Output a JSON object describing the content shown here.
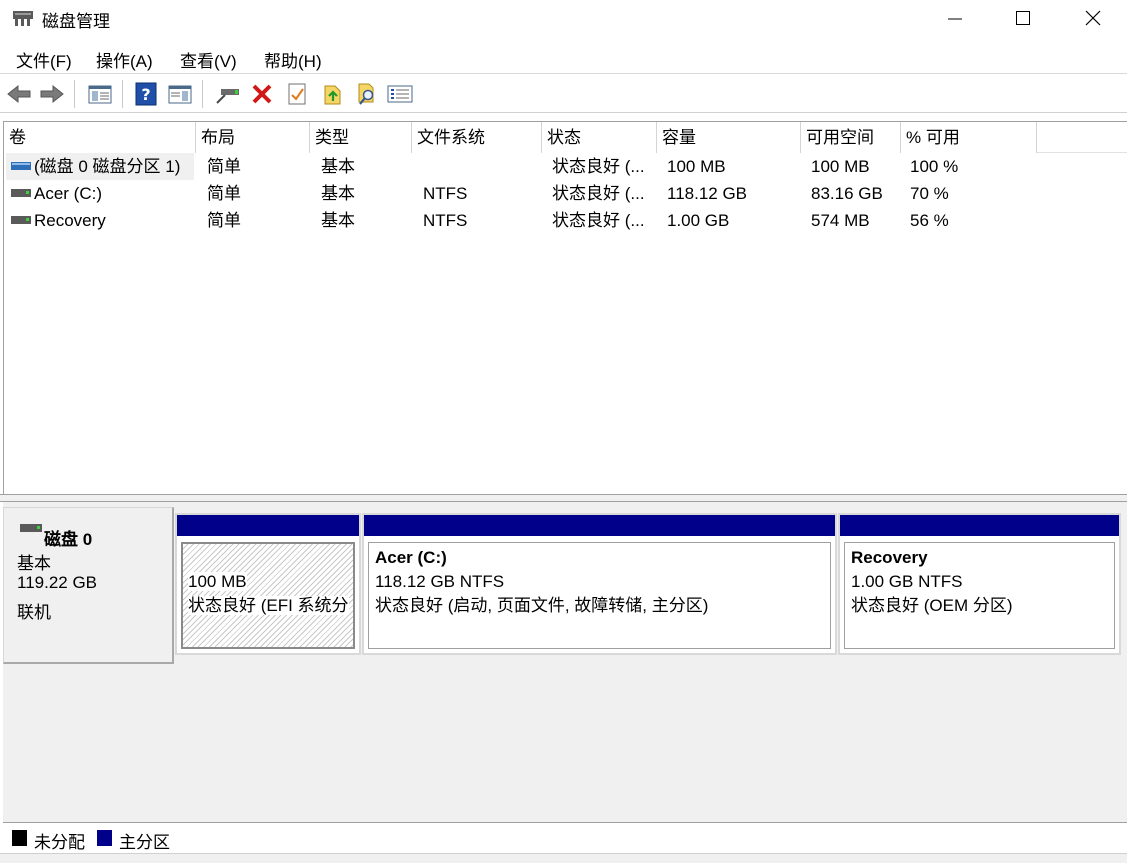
{
  "window": {
    "title": "磁盘管理",
    "controls": {
      "minimize": "minimize-icon",
      "maximize": "maximize-icon",
      "close": "close-icon"
    }
  },
  "menu": [
    "文件(F)",
    "操作(A)",
    "查看(V)",
    "帮助(H)"
  ],
  "toolbar": {
    "buttons": [
      "back-arrow-icon",
      "forward-arrow-icon",
      "console-tree-icon",
      "help-icon",
      "action-pane-icon",
      "connect-disk-icon",
      "delete-icon",
      "properties-icon",
      "export-icon",
      "search-icon",
      "list-view-icon"
    ]
  },
  "volume_table": {
    "columns": [
      "卷",
      "布局",
      "类型",
      "文件系统",
      "状态",
      "容量",
      "可用空间",
      "% 可用"
    ],
    "rows": [
      {
        "volume": "(磁盘 0 磁盘分区 1)",
        "layout": "简单",
        "type": "基本",
        "fs": "",
        "status": "状态良好 (...",
        "capacity": "100 MB",
        "free": "100 MB",
        "pct": "100 %"
      },
      {
        "volume": "Acer (C:)",
        "layout": "简单",
        "type": "基本",
        "fs": "NTFS",
        "status": "状态良好 (...",
        "capacity": "118.12 GB",
        "free": "83.16 GB",
        "pct": "70 %"
      },
      {
        "volume": "Recovery",
        "layout": "简单",
        "type": "基本",
        "fs": "NTFS",
        "status": "状态良好 (...",
        "capacity": "1.00 GB",
        "free": "574 MB",
        "pct": "56 %"
      }
    ]
  },
  "disk": {
    "name": "磁盘 0",
    "type": "基本",
    "size": "119.22 GB",
    "state": "联机",
    "partitions": [
      {
        "name": "",
        "size_fs": "100 MB",
        "status": "状态良好 (EFI 系统分"
      },
      {
        "name": "Acer  (C:)",
        "size_fs": "118.12 GB NTFS",
        "status": "状态良好 (启动, 页面文件, 故障转储, 主分区)"
      },
      {
        "name": "Recovery",
        "size_fs": "1.00 GB NTFS",
        "status": "状态良好 (OEM 分区)"
      }
    ]
  },
  "legend": [
    {
      "label": "未分配",
      "color": "#000000"
    },
    {
      "label": "主分区",
      "color": "#00008b"
    }
  ],
  "colors": {
    "primary_partition": "#00008b",
    "unallocated": "#000000"
  }
}
